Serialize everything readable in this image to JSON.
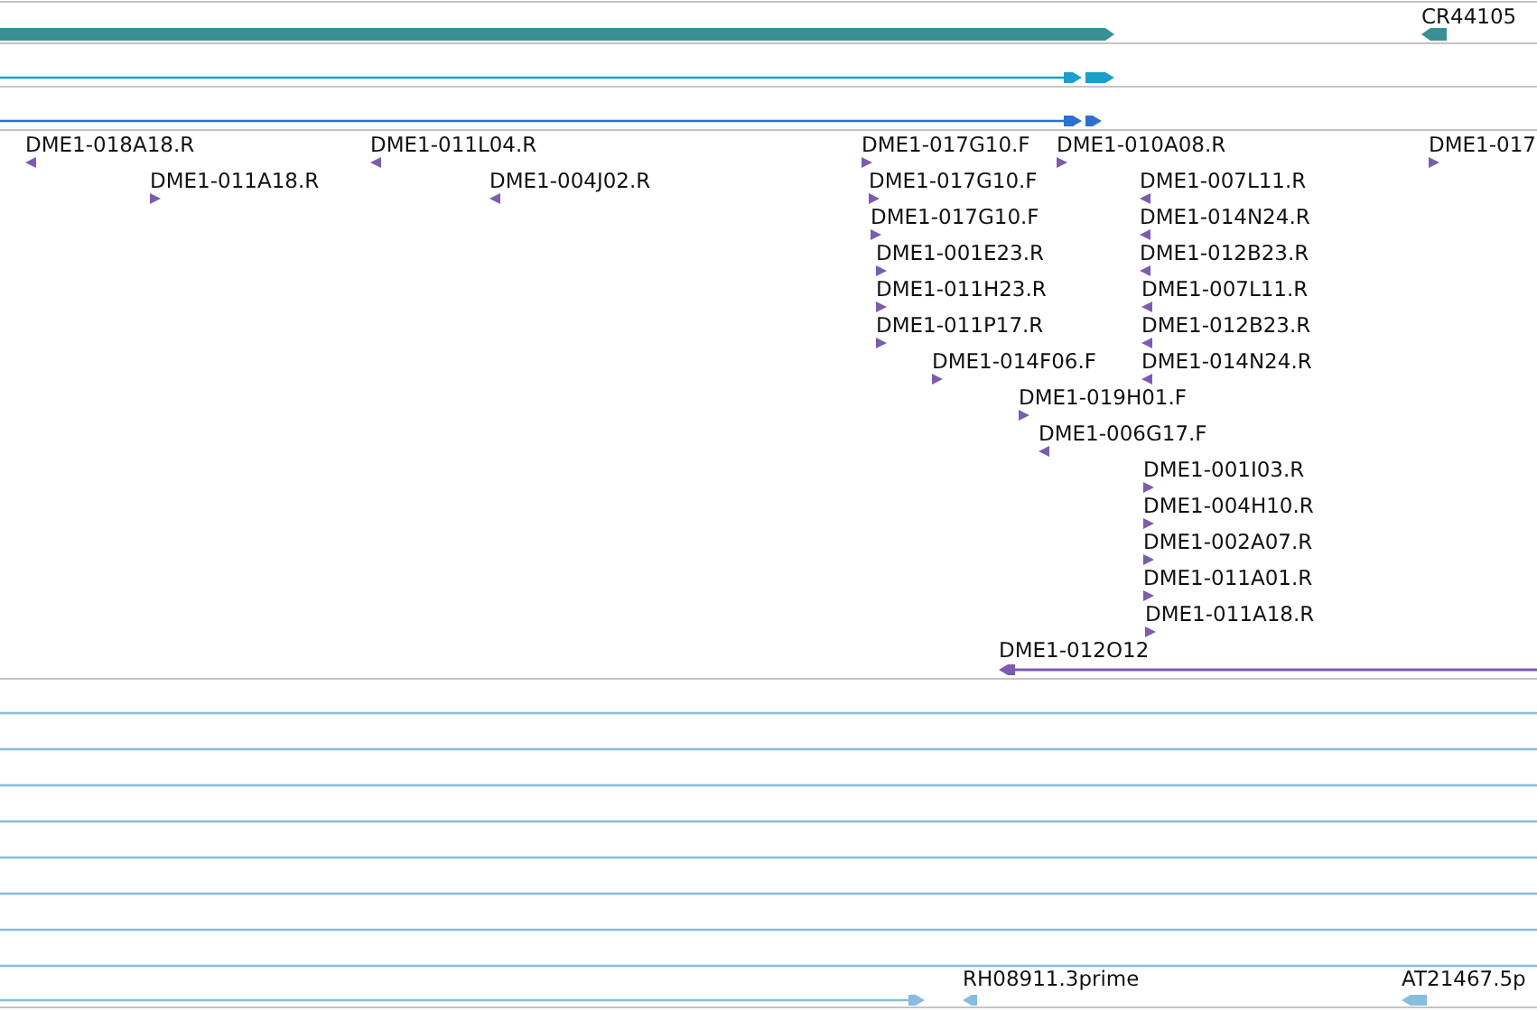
{
  "tracks": [
    {
      "kind": "gene",
      "features": [
        {
          "reverse": false
        },
        {
          "label": "CR44105",
          "reverse": true
        }
      ]
    },
    {
      "kind": "mrna",
      "features": [
        {
          "reverse": false
        }
      ]
    },
    {
      "kind": "cds",
      "features": [
        {
          "reverse": false
        }
      ]
    },
    {
      "kind": "est",
      "features": [
        {
          "label": "DME1-018A18.R",
          "reverse": true
        },
        {
          "label": "DME1-011L04.R",
          "reverse": true
        },
        {
          "label": "DME1-017G10.F",
          "reverse": false
        },
        {
          "label": "DME1-010A08.R",
          "reverse": false
        },
        {
          "label": "DME1-017",
          "reverse": false
        },
        {
          "label": "DME1-011A18.R",
          "reverse": false
        },
        {
          "label": "DME1-004J02.R",
          "reverse": true
        },
        {
          "label": "DME1-017G10.F",
          "reverse": false
        },
        {
          "label": "DME1-007L11.R",
          "reverse": true
        },
        {
          "label": "DME1-017G10.F",
          "reverse": false
        },
        {
          "label": "DME1-014N24.R",
          "reverse": true
        },
        {
          "label": "DME1-001E23.R",
          "reverse": false
        },
        {
          "label": "DME1-012B23.R",
          "reverse": true
        },
        {
          "label": "DME1-011H23.R",
          "reverse": false
        },
        {
          "label": "DME1-007L11.R",
          "reverse": true
        },
        {
          "label": "DME1-011P17.R",
          "reverse": false
        },
        {
          "label": "DME1-012B23.R",
          "reverse": true
        },
        {
          "label": "DME1-014F06.F",
          "reverse": false
        },
        {
          "label": "DME1-014N24.R",
          "reverse": true
        },
        {
          "label": "DME1-019H01.F",
          "reverse": false
        },
        {
          "label": "DME1-006G17.F",
          "reverse": true
        },
        {
          "label": "DME1-001I03.R",
          "reverse": false
        },
        {
          "label": "DME1-004H10.R",
          "reverse": false
        },
        {
          "label": "DME1-002A07.R",
          "reverse": false
        },
        {
          "label": "DME1-011A01.R",
          "reverse": false
        },
        {
          "label": "DME1-011A18.R",
          "reverse": false
        },
        {
          "label": "DME1-012O12",
          "reverse": true,
          "kind": "clone"
        }
      ]
    },
    {
      "kind": "cdna",
      "features": [
        {
          "reverse": false
        },
        {
          "label": "RH08911.3prime",
          "reverse": true
        },
        {
          "label": "AT21467.5p",
          "reverse": true
        }
      ]
    }
  ]
}
